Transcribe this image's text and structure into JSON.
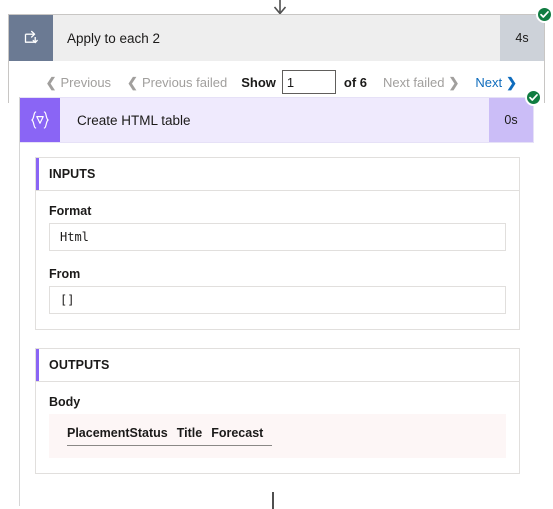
{
  "loop_action": {
    "title": "Apply to each 2",
    "duration": "4s",
    "icon": "loop-icon",
    "status": "succeeded",
    "status_icon": "checkmark-circle-icon"
  },
  "pagination": {
    "previous_label": "Previous",
    "previous_failed_label": "Previous failed",
    "show_label": "Show",
    "page_value": "1",
    "page_placeholder": "",
    "of_label": "of 6",
    "total_pages": 6,
    "next_failed_label": "Next failed",
    "next_label": "Next",
    "chevron_left": "❮",
    "chevron_right": "❯"
  },
  "inner_action": {
    "title": "Create HTML table",
    "duration": "0s",
    "icon": "braces-nabla-icon",
    "status": "succeeded",
    "status_icon": "checkmark-circle-icon",
    "inputs": {
      "section_title": "INPUTS",
      "fields": [
        {
          "label": "Format",
          "value": "Html"
        },
        {
          "label": "From",
          "value": "[]"
        }
      ]
    },
    "outputs": {
      "section_title": "OUTPUTS",
      "body_label": "Body",
      "table_headers": [
        "PlacementStatus",
        "Title",
        "Forecast"
      ],
      "table_rows": []
    }
  },
  "colors": {
    "loop_icon_bg": "#6b7a93",
    "loop_header_bg": "#eeeeee",
    "loop_duration_bg": "#cdd2d9",
    "action_icon_bg": "#8a65f5",
    "action_header_bg": "#efeafd",
    "action_duration_bg": "#cbbdf7",
    "accent": "#8a65f5",
    "success": "#107c41",
    "link": "#0f6cbd",
    "disabled_text": "#a19f9d",
    "body_table_bg": "#fdf6f6"
  }
}
